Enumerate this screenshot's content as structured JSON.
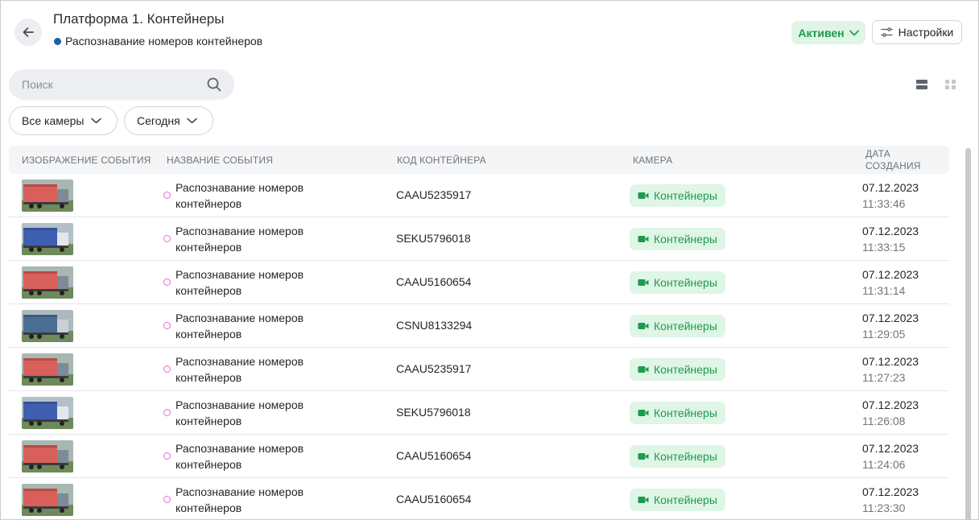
{
  "header": {
    "title": "Платформа 1. Контейнеры",
    "subtitle": "Распознавание номеров контейнеров",
    "status_label": "Активен",
    "settings_label": "Настройки",
    "status_color": "#1d9b4c"
  },
  "search": {
    "placeholder": "Поиск",
    "value": ""
  },
  "filters": {
    "cameras": "Все камеры",
    "period": "Сегодня"
  },
  "table": {
    "columns": [
      "Изображение события",
      "Название события",
      "Код контейнера",
      "Камера",
      "Дата создания"
    ],
    "rows": [
      {
        "thumb": "red-container-truck",
        "event": "Распознавание номеров контейнеров",
        "code": "CAAU5235917",
        "camera": "Контейнеры",
        "date": "07.12.2023",
        "time": "11:33:46"
      },
      {
        "thumb": "blue-container-truck",
        "event": "Распознавание номеров контейнеров",
        "code": "SEKU5796018",
        "camera": "Контейнеры",
        "date": "07.12.2023",
        "time": "11:33:15"
      },
      {
        "thumb": "red-container-truck",
        "event": "Распознавание номеров контейнеров",
        "code": "CAAU5160654",
        "camera": "Контейнеры",
        "date": "07.12.2023",
        "time": "11:31:14"
      },
      {
        "thumb": "grey-blue-container-truck",
        "event": "Распознавание номеров контейнеров",
        "code": "CSNU8133294",
        "camera": "Контейнеры",
        "date": "07.12.2023",
        "time": "11:29:05"
      },
      {
        "thumb": "red-container-truck",
        "event": "Распознавание номеров контейнеров",
        "code": "CAAU5235917",
        "camera": "Контейнеры",
        "date": "07.12.2023",
        "time": "11:27:23"
      },
      {
        "thumb": "blue-container-truck",
        "event": "Распознавание номеров контейнеров",
        "code": "SEKU5796018",
        "camera": "Контейнеры",
        "date": "07.12.2023",
        "time": "11:26:08"
      },
      {
        "thumb": "red-container-truck",
        "event": "Распознавание номеров контейнеров",
        "code": "CAAU5160654",
        "camera": "Контейнеры",
        "date": "07.12.2023",
        "time": "11:24:06"
      },
      {
        "thumb": "red-container-truck",
        "event": "Распознавание номеров контейнеров",
        "code": "CAAU5160654",
        "camera": "Контейнеры",
        "date": "07.12.2023",
        "time": "11:23:30"
      }
    ]
  },
  "colors": {
    "accent_green": "#1d9b4c",
    "chip_bg": "#dff5e6",
    "event_dot": "#e36bd1",
    "subtitle_dot": "#1e5fa8"
  }
}
